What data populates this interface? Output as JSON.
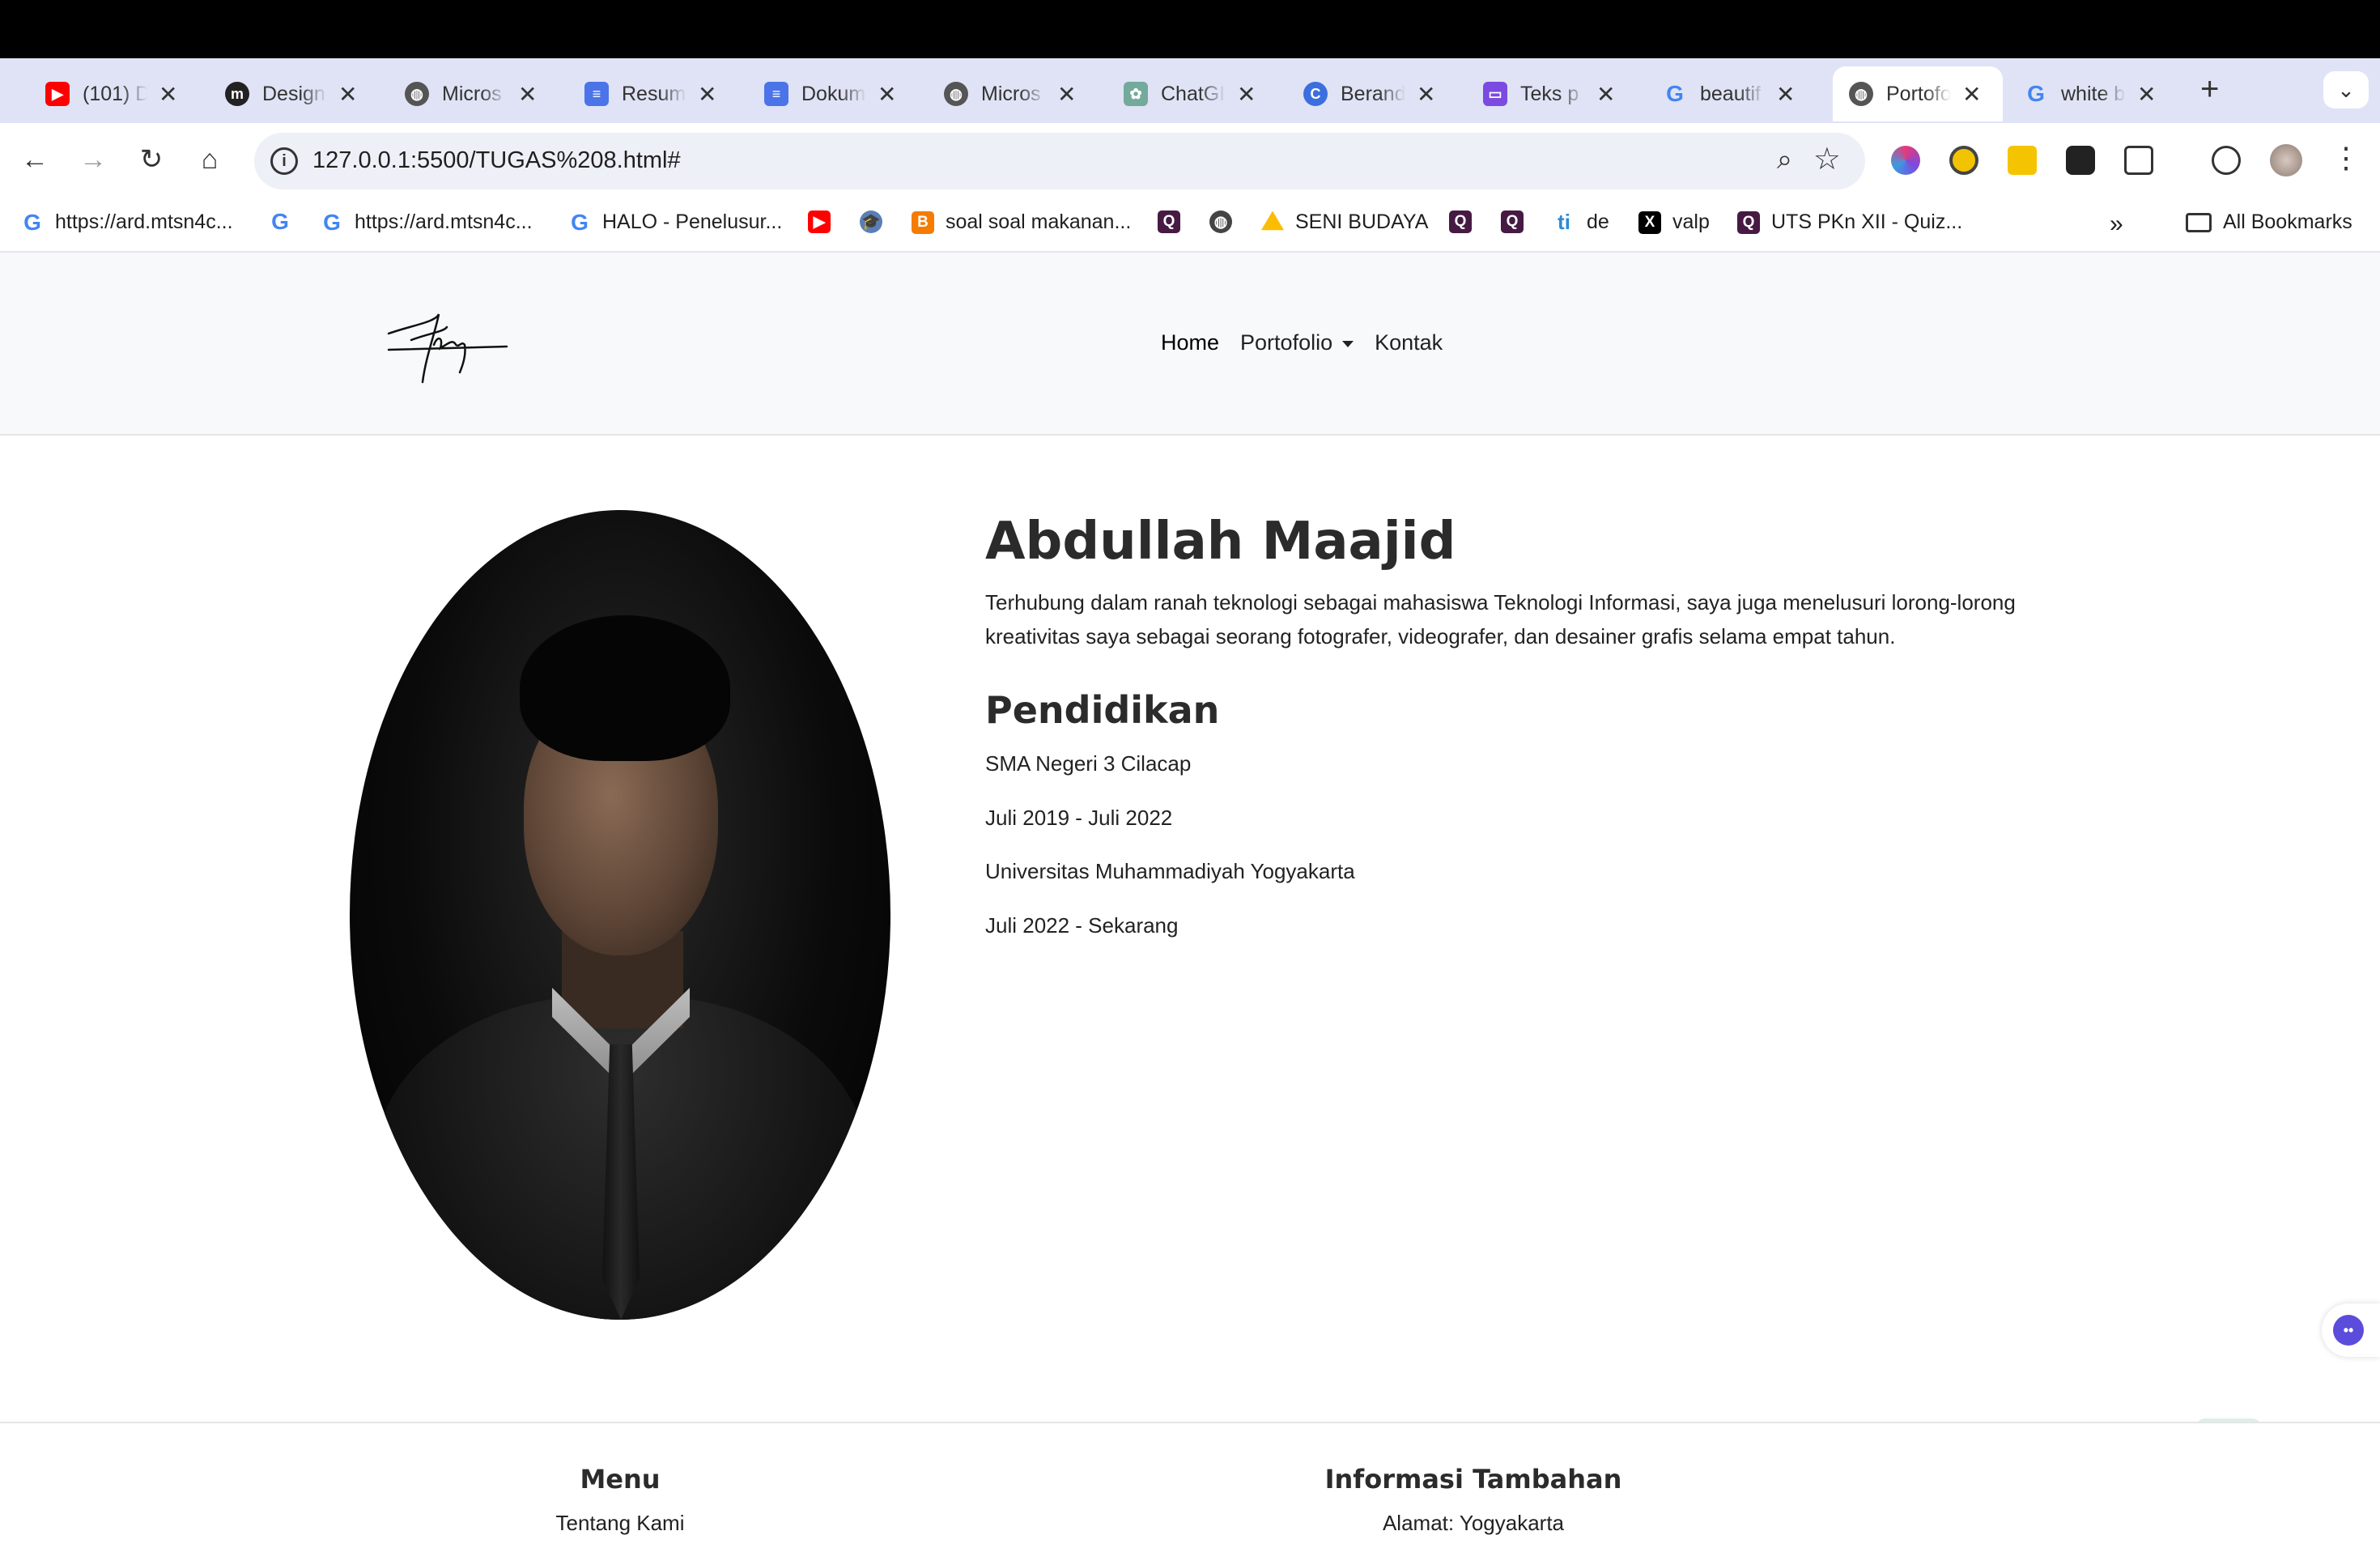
{
  "browser": {
    "tabs": [
      {
        "title": "(101) D",
        "icon": "youtube-icon",
        "color": "#ff0000"
      },
      {
        "title": "Design",
        "icon": "m-icon",
        "color": "#222222"
      },
      {
        "title": "Micros",
        "icon": "globe-icon",
        "color": "#555555"
      },
      {
        "title": "Resum",
        "icon": "docs-icon",
        "color": "#4a74e8"
      },
      {
        "title": "Dokum",
        "icon": "docs-icon",
        "color": "#4a74e8"
      },
      {
        "title": "Micros",
        "icon": "globe-icon",
        "color": "#555555"
      },
      {
        "title": "ChatGI",
        "icon": "chatgpt-icon",
        "color": "#74aa9c"
      },
      {
        "title": "Berand",
        "icon": "canva-icon",
        "color": "#3b6fe0"
      },
      {
        "title": "Teks p",
        "icon": "app-icon",
        "color": "#7b4ae0"
      },
      {
        "title": "beautif",
        "icon": "google-icon",
        "color": "#4285f4"
      },
      {
        "title": "Portofo",
        "icon": "globe-icon",
        "color": "#555555"
      },
      {
        "title": "white b",
        "icon": "google-icon",
        "color": "#4285f4"
      }
    ],
    "active_tab": 10,
    "url": "127.0.0.1:5500/TUGAS%208.html#",
    "bookmarks": [
      {
        "label": "https://ard.mtsn4c...",
        "icon": "google-icon"
      },
      {
        "label": "",
        "icon": "google-icon"
      },
      {
        "label": "https://ard.mtsn4c...",
        "icon": "google-icon"
      },
      {
        "label": "HALO - Penelusur...",
        "icon": "google-icon"
      },
      {
        "label": "",
        "icon": "youtube-icon"
      },
      {
        "label": "",
        "icon": "graduation-cap-icon"
      },
      {
        "label": "soal soal makanan...",
        "icon": "blogger-icon"
      },
      {
        "label": "",
        "icon": "quizizz-icon"
      },
      {
        "label": "",
        "icon": "globe-icon"
      },
      {
        "label": "SENI BUDAYA",
        "icon": "drive-icon"
      },
      {
        "label": "",
        "icon": "quizizz-icon"
      },
      {
        "label": "",
        "icon": "quizizz-icon"
      },
      {
        "label": "de",
        "icon": "ti-icon"
      },
      {
        "label": "valp",
        "icon": "x-icon"
      },
      {
        "label": "UTS PKn XII - Quiz...",
        "icon": "quizizz-icon"
      }
    ],
    "all_bookmarks": "All Bookmarks"
  },
  "site": {
    "nav": {
      "home": "Home",
      "portfolio": "Portofolio",
      "contact": "Kontak"
    },
    "profile": {
      "name": "Abdullah Maajid",
      "bio": "Terhubung dalam ranah teknologi sebagai mahasiswa Teknologi Informasi, saya juga menelusuri lorong-lorong kreativitas saya sebagai seorang fotografer, videografer, dan desainer grafis selama empat tahun."
    },
    "education": {
      "title": "Pendidikan",
      "items": [
        "SMA Negeri 3 Cilacap",
        "Juli 2019 - Juli 2022",
        "Universitas Muhammadiyah Yogyakarta",
        "Juli 2022 - Sekarang"
      ]
    },
    "footer": {
      "menu_title": "Menu",
      "menu_item": "Tentang Kami",
      "info_title": "Informasi Tambahan",
      "info_item": "Alamat: Yogyakarta"
    }
  }
}
